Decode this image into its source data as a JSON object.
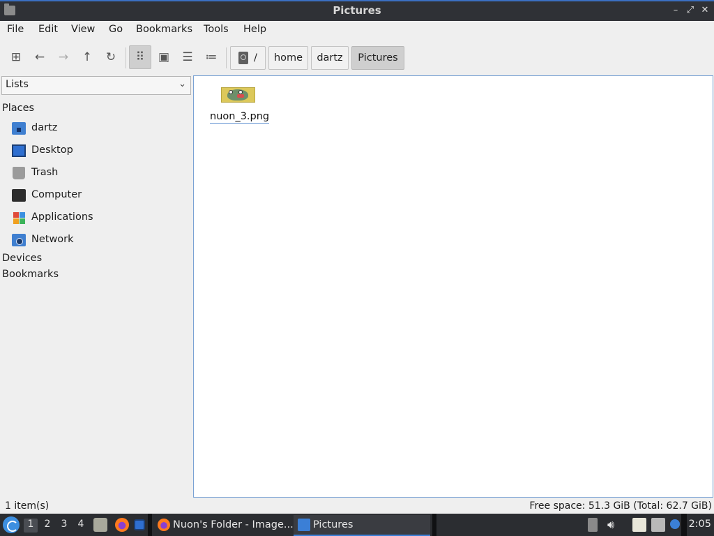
{
  "window": {
    "title": "Pictures",
    "controls": {
      "minimize": "–",
      "maximize": "⤢",
      "close": "✕"
    }
  },
  "menubar": [
    "File",
    "Edit",
    "View",
    "Go",
    "Bookmarks",
    "Tools",
    "Help"
  ],
  "toolbar": {
    "buttons": [
      {
        "name": "new-tab-icon",
        "glyph": "⊞"
      },
      {
        "name": "back-icon",
        "glyph": "←"
      },
      {
        "name": "forward-icon",
        "glyph": "→"
      },
      {
        "name": "up-icon",
        "glyph": "↑"
      },
      {
        "name": "reload-icon",
        "glyph": "↻"
      },
      {
        "name": "icon-view-icon",
        "glyph": "⠿",
        "active": true
      },
      {
        "name": "thumbnail-view-icon",
        "glyph": "▣"
      },
      {
        "name": "compact-view-icon",
        "glyph": "☰"
      },
      {
        "name": "detailed-list-icon",
        "glyph": "≔"
      }
    ],
    "breadcrumb": [
      "/",
      "home",
      "dartz",
      "Pictures"
    ]
  },
  "sidebar": {
    "select_value": "Lists",
    "places_heading": "Places",
    "items": [
      {
        "label": "dartz",
        "icon": "home-folder-icon"
      },
      {
        "label": "Desktop",
        "icon": "desktop-icon"
      },
      {
        "label": "Trash",
        "icon": "trash-icon"
      },
      {
        "label": "Computer",
        "icon": "computer-icon"
      },
      {
        "label": "Applications",
        "icon": "applications-icon"
      },
      {
        "label": "Network",
        "icon": "network-icon"
      }
    ],
    "devices_heading": "Devices",
    "bookmarks_heading": "Bookmarks"
  },
  "content": {
    "files": [
      {
        "name": "nuon_3.png",
        "icon": "image-thumbnail"
      }
    ]
  },
  "statusbar": {
    "left": "1 item(s)",
    "right": "Free space: 51.3 GiB (Total: 62.7 GiB)"
  },
  "taskbar": {
    "workspaces": [
      "1",
      "2",
      "3",
      "4"
    ],
    "active_workspace": "1",
    "tasks": [
      {
        "label": "Nuon's Folder - Image...",
        "icon": "firefox-icon",
        "active": false
      },
      {
        "label": "Pictures",
        "icon": "folder-icon",
        "active": true
      }
    ],
    "clock": "2:05"
  },
  "colors": {
    "accent": "#3b7fd6",
    "titlebar_bg": "#2f3136",
    "taskbar_bg": "#2b2d31",
    "content_border": "#7aa2d4"
  }
}
